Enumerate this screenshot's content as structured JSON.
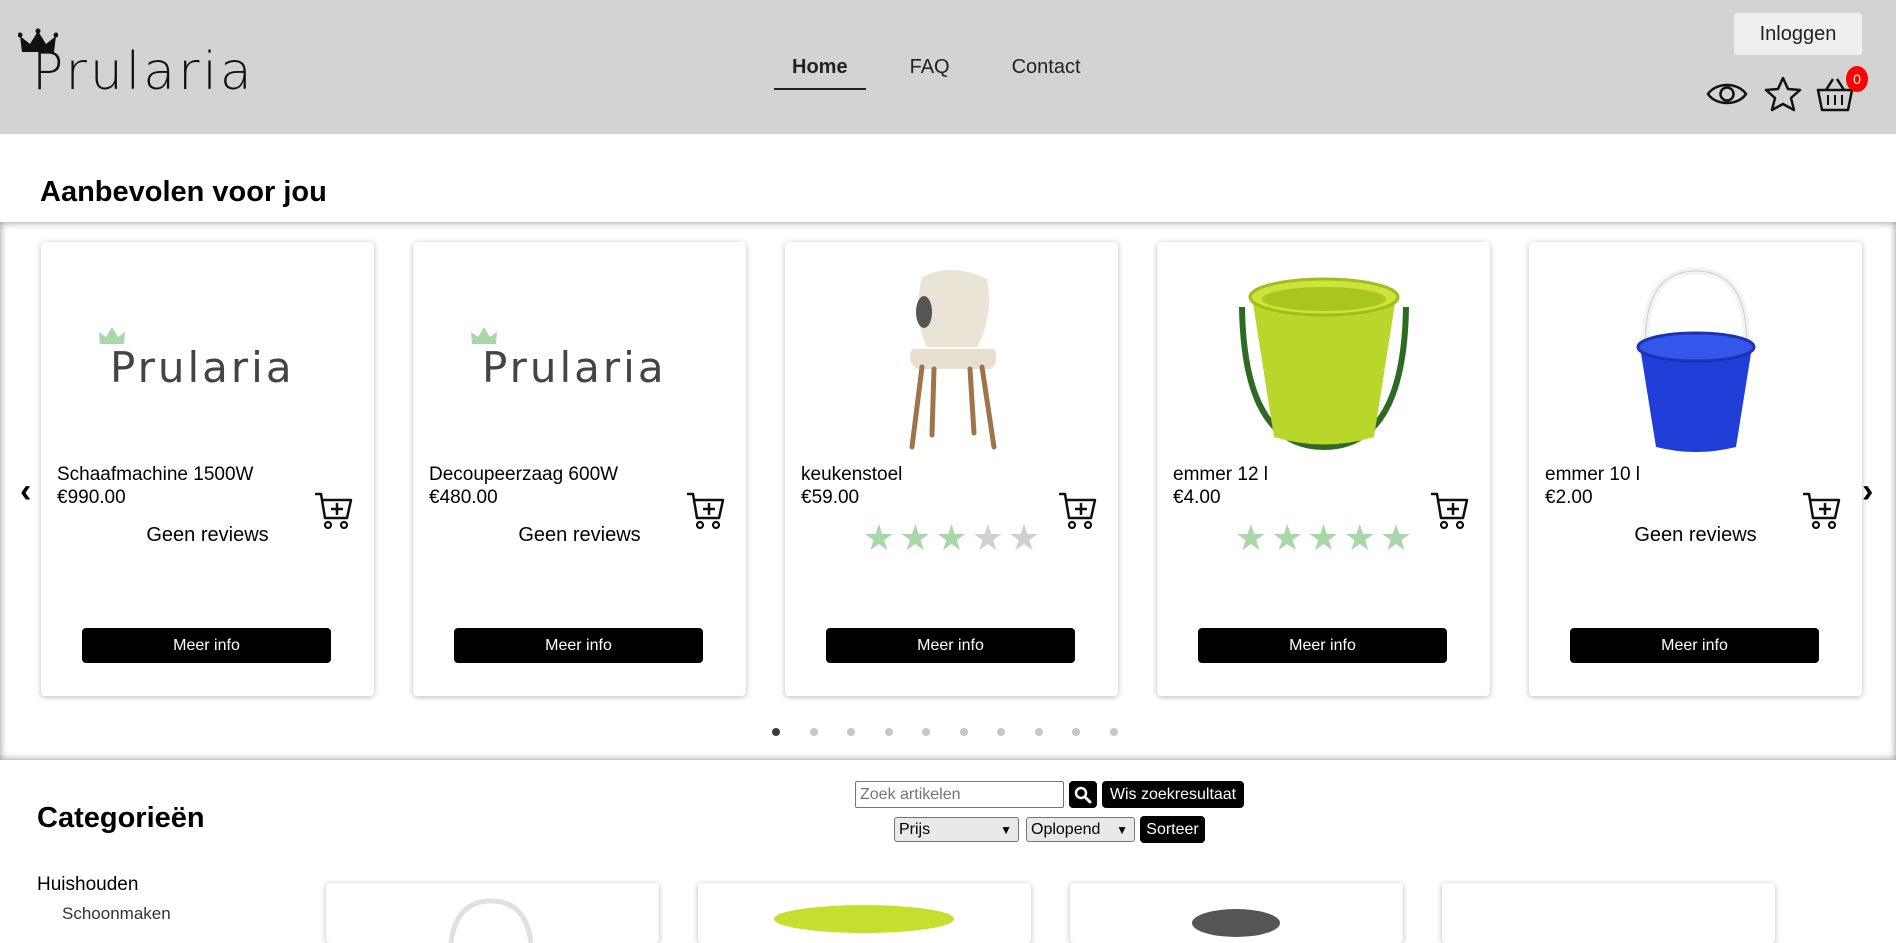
{
  "header": {
    "logo_text": "Prularia",
    "nav": [
      {
        "label": "Home",
        "active": true
      },
      {
        "label": "FAQ",
        "active": false
      },
      {
        "label": "Contact",
        "active": false
      }
    ],
    "login_label": "Inloggen",
    "icons": [
      "eye-icon",
      "star-icon",
      "basket-icon"
    ],
    "cart_count": "0"
  },
  "recommended": {
    "title": "Aanbevolen voor jou",
    "prev_arrow": "‹",
    "next_arrow": "›",
    "products": [
      {
        "name": "Schaafmachine 1500W",
        "price": "€990.00",
        "reviews": "Geen reviews",
        "rating": null,
        "image": "prularia-logo",
        "button": "Meer info"
      },
      {
        "name": "Decoupeerzaag 600W",
        "price": "€480.00",
        "reviews": "Geen reviews",
        "rating": null,
        "image": "prularia-logo",
        "button": "Meer info"
      },
      {
        "name": "keukenstoel",
        "price": "€59.00",
        "reviews": "",
        "rating": 3,
        "image": "chair",
        "button": "Meer info"
      },
      {
        "name": "emmer 12 l",
        "price": "€4.00",
        "reviews": "",
        "rating": 5,
        "image": "green-bucket",
        "button": "Meer info"
      },
      {
        "name": "emmer 10 l",
        "price": "€2.00",
        "reviews": "Geen reviews",
        "rating": null,
        "image": "blue-bucket",
        "button": "Meer info"
      }
    ],
    "dots_total": 10,
    "dots_active": 1
  },
  "categories": {
    "title": "Categorieën",
    "items": [
      {
        "label": "Huishouden"
      },
      {
        "label": "Schoonmaken"
      }
    ]
  },
  "search": {
    "placeholder": "Zoek artikelen",
    "clear_label": "Wis zoekresultaat",
    "sort_field": "Prijs",
    "sort_order": "Oplopend",
    "sort_label": "Sorteer"
  },
  "colors": {
    "header_bg": "#d3d3d3",
    "badge": "#ff0000",
    "star_on": "#a8d8a8",
    "star_off": "#d0d0d0"
  }
}
